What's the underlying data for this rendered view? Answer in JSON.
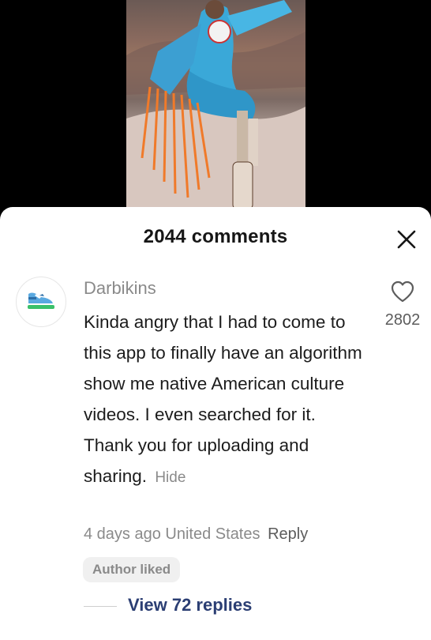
{
  "video": {
    "icon": "video-thumbnail"
  },
  "comments": {
    "title": "2044 comments",
    "close_icon": "close-icon"
  },
  "comment": {
    "avatar_icon": "sneaker-icon",
    "username": "Darbikins",
    "text": "Kinda angry that I had to come to this app to finally have an algorithm show me native American culture videos. I even searched for it. Thank you for uploading and sharing.",
    "hide_label": "Hide",
    "like_icon": "heart-outline-icon",
    "like_count": "2802",
    "time": "4 days ago",
    "location": "United States",
    "reply_label": "Reply",
    "author_badge": "Author liked",
    "view_replies": "View 72 replies"
  }
}
